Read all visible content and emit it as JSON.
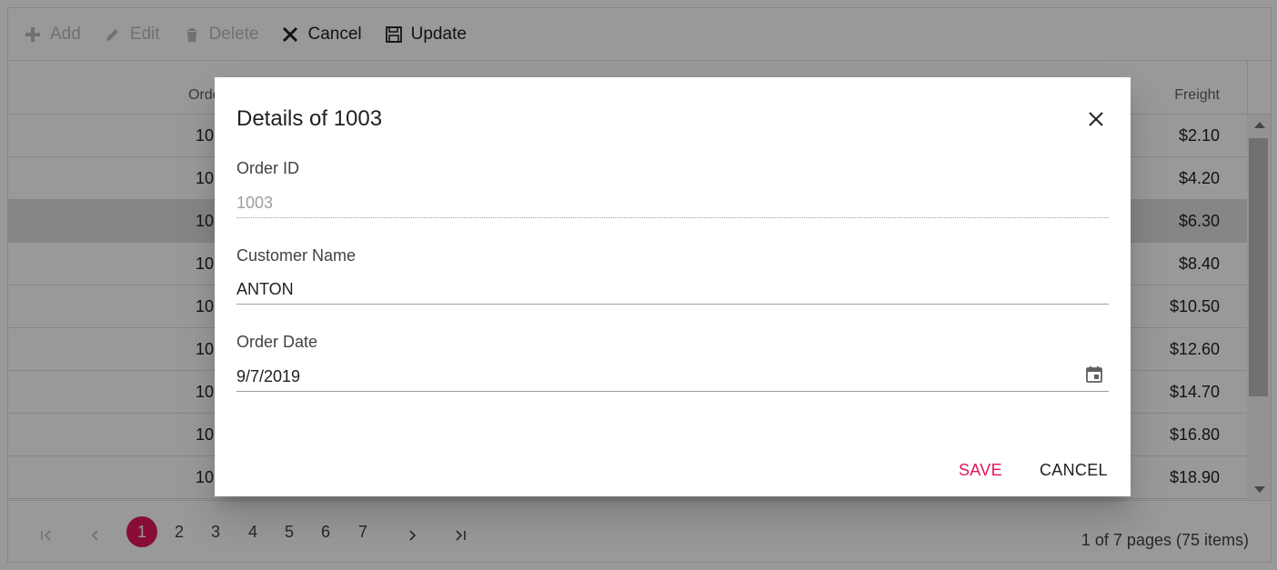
{
  "toolbar": {
    "items": [
      {
        "label": "Add",
        "icon": "plus-icon",
        "enabled": false
      },
      {
        "label": "Edit",
        "icon": "pencil-icon",
        "enabled": false
      },
      {
        "label": "Delete",
        "icon": "trash-icon",
        "enabled": false
      },
      {
        "label": "Cancel",
        "icon": "close-icon",
        "enabled": true
      },
      {
        "label": "Update",
        "icon": "save-icon",
        "enabled": true
      }
    ]
  },
  "grid": {
    "columns": {
      "order_id": "Orde",
      "freight": "Freight"
    },
    "rows": [
      {
        "order_id": "10",
        "freight": "$2.10",
        "selected": false
      },
      {
        "order_id": "10",
        "freight": "$4.20",
        "selected": false
      },
      {
        "order_id": "10",
        "freight": "$6.30",
        "selected": true
      },
      {
        "order_id": "10",
        "freight": "$8.40",
        "selected": false
      },
      {
        "order_id": "10",
        "freight": "$10.50",
        "selected": false
      },
      {
        "order_id": "10",
        "freight": "$12.60",
        "selected": false
      },
      {
        "order_id": "10",
        "freight": "$14.70",
        "selected": false
      },
      {
        "order_id": "10",
        "freight": "$16.80",
        "selected": false
      },
      {
        "order_id": "10",
        "freight": "$18.90",
        "selected": false
      }
    ]
  },
  "pager": {
    "pages": [
      "1",
      "2",
      "3",
      "4",
      "5",
      "6",
      "7"
    ],
    "current_page": "1",
    "info": "1 of 7 pages (75 items)"
  },
  "dialog": {
    "title": "Details of 1003",
    "fields": {
      "order_id": {
        "label": "Order ID",
        "value": "1003"
      },
      "customer_name": {
        "label": "Customer Name",
        "value": "ANTON"
      },
      "order_date": {
        "label": "Order Date",
        "value": "9/7/2019"
      }
    },
    "save_label": "SAVE",
    "cancel_label": "CANCEL"
  },
  "colors": {
    "accent": "#e3165b",
    "overlay": "rgba(0,0,0,0.4)"
  }
}
